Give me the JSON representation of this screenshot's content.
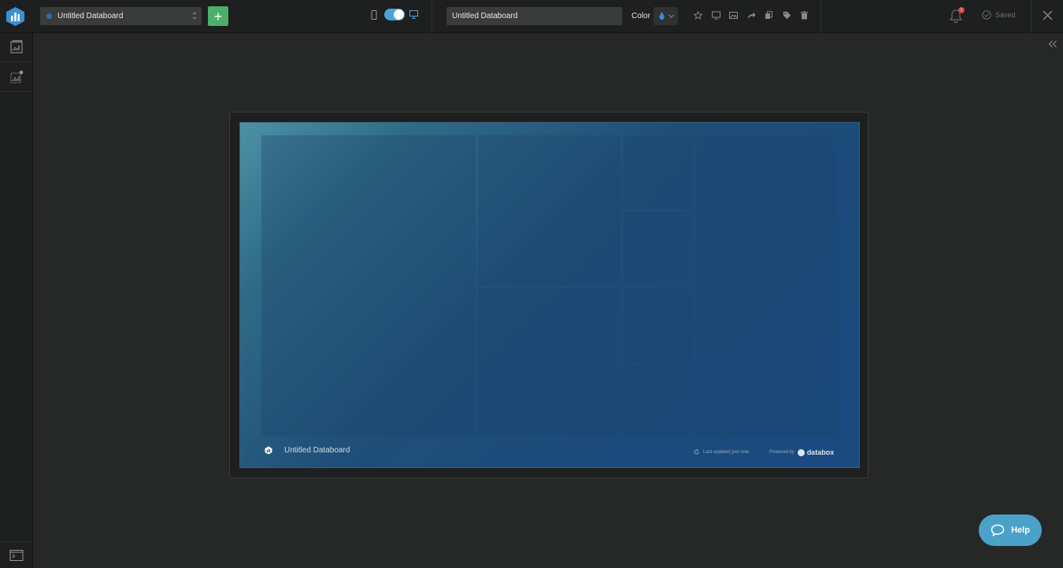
{
  "header": {
    "board_select": {
      "selected": "Untitled Databoard"
    },
    "add_button_label": "+",
    "title_input": {
      "value": "Untitled Databoard"
    },
    "color_label": "Color",
    "notifications_count": "1",
    "save_status": "Saved"
  },
  "preview": {
    "footer_title": "Untitled Databoard",
    "last_updated": "Last updated just now",
    "powered_by": "Powered by",
    "brand": "databox"
  },
  "help_label": "Help",
  "colors": {
    "accent_green": "#4caf6b",
    "toggle_blue": "#4ba3d8",
    "help_blue": "#4aa2c9",
    "badge_red": "#d9413b"
  }
}
